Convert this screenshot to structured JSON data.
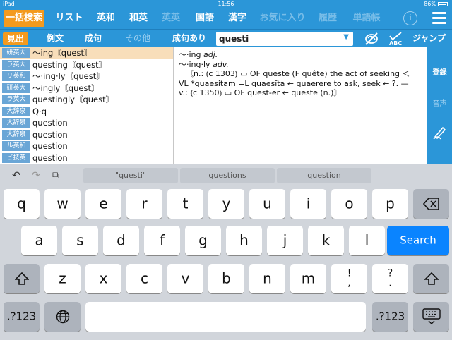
{
  "status": {
    "device": "iPad",
    "time": "11:56",
    "battery": "86%"
  },
  "nav": {
    "tabs": [
      {
        "label": "一括検索",
        "active": true,
        "dim": false
      },
      {
        "label": "リスト",
        "active": false,
        "dim": false
      },
      {
        "label": "英和",
        "active": false,
        "dim": false
      },
      {
        "label": "和英",
        "active": false,
        "dim": false
      },
      {
        "label": "英英",
        "active": false,
        "dim": true
      },
      {
        "label": "国語",
        "active": false,
        "dim": false
      },
      {
        "label": "漢字",
        "active": false,
        "dim": false
      },
      {
        "label": "お気に入り",
        "active": false,
        "dim": true
      },
      {
        "label": "履歴",
        "active": false,
        "dim": true
      },
      {
        "label": "単語帳",
        "active": false,
        "dim": true
      }
    ],
    "info_icon": "info-icon",
    "menu_icon": "hamburger-menu-icon"
  },
  "subnav": {
    "items": [
      {
        "label": "見出",
        "active": true,
        "dim": false
      },
      {
        "label": "例文",
        "active": false,
        "dim": false
      },
      {
        "label": "成句",
        "active": false,
        "dim": false
      },
      {
        "label": "その他",
        "active": false,
        "dim": true
      },
      {
        "label": "成句あり",
        "active": false,
        "dim": false
      }
    ],
    "search_value": "questi",
    "jump_label": "ジャンプ",
    "icons": [
      "no-pronunciation-icon",
      "spell-check-abc-icon"
    ]
  },
  "results": [
    {
      "source": "研英大",
      "word": "～ing〘quest〙",
      "selected": true
    },
    {
      "source": "ラ英大",
      "word": "questing〘quest〙",
      "selected": false
    },
    {
      "source": "リ英和",
      "word": "～·ing·ly〘quest〙",
      "selected": false
    },
    {
      "source": "研英大",
      "word": "～ingly〘quest〙",
      "selected": false
    },
    {
      "source": "ラ英大",
      "word": "questingly〘quest〙",
      "selected": false
    },
    {
      "source": "大辞泉",
      "word": "Q·q",
      "selected": false
    },
    {
      "source": "大辞泉",
      "word": "question",
      "selected": false
    },
    {
      "source": "大辞泉",
      "word": "question",
      "selected": false
    },
    {
      "source": "ル英和",
      "word": "question",
      "selected": false
    },
    {
      "source": "ビ技英",
      "word": "question",
      "selected": false
    }
  ],
  "entry": {
    "line1_head": "～·ing",
    "line1_pos": "adj.",
    "line2_head": "～·ing·ly",
    "line2_pos": "adv.",
    "etymology": [
      "〘n.: ⦅c 1303⦆ ▭ OF queste (F quête) the act of seeking ＜",
      "VL *quaesitam =L quaesīta ← quaerere to ask, seek ← ?. —",
      "v.: ⦅c 1350⦆ ▭ OF quest-er ← queste (n.)〙"
    ]
  },
  "sidebar": {
    "items": [
      {
        "label": "登録",
        "dim": false
      },
      {
        "label": "音声",
        "dim": true
      }
    ],
    "icons": [
      "handwriting-pen-icon"
    ]
  },
  "keyboard": {
    "toolbar_icons": [
      "undo-icon",
      "redo-icon",
      "paste-icon"
    ],
    "suggestions": [
      "\"questi\"",
      "questions",
      "question"
    ],
    "row1": [
      "q",
      "w",
      "e",
      "r",
      "t",
      "y",
      "u",
      "i",
      "o",
      "p"
    ],
    "row2": [
      "a",
      "s",
      "d",
      "f",
      "g",
      "h",
      "j",
      "k",
      "l"
    ],
    "row3": [
      "z",
      "x",
      "c",
      "v",
      "b",
      "n",
      "m",
      "!\n,",
      "?\n."
    ],
    "backspace_icon": "backspace-icon",
    "shift_icon": "shift-icon",
    "globe_icon": "globe-icon",
    "hide_keyboard_icon": "keyboard-dismiss-icon",
    "numbers_label": ".?123",
    "search_label": "Search",
    "accent": "#2b96d8",
    "highlight": "#f39a1e",
    "search_color": "#0a84ff"
  }
}
